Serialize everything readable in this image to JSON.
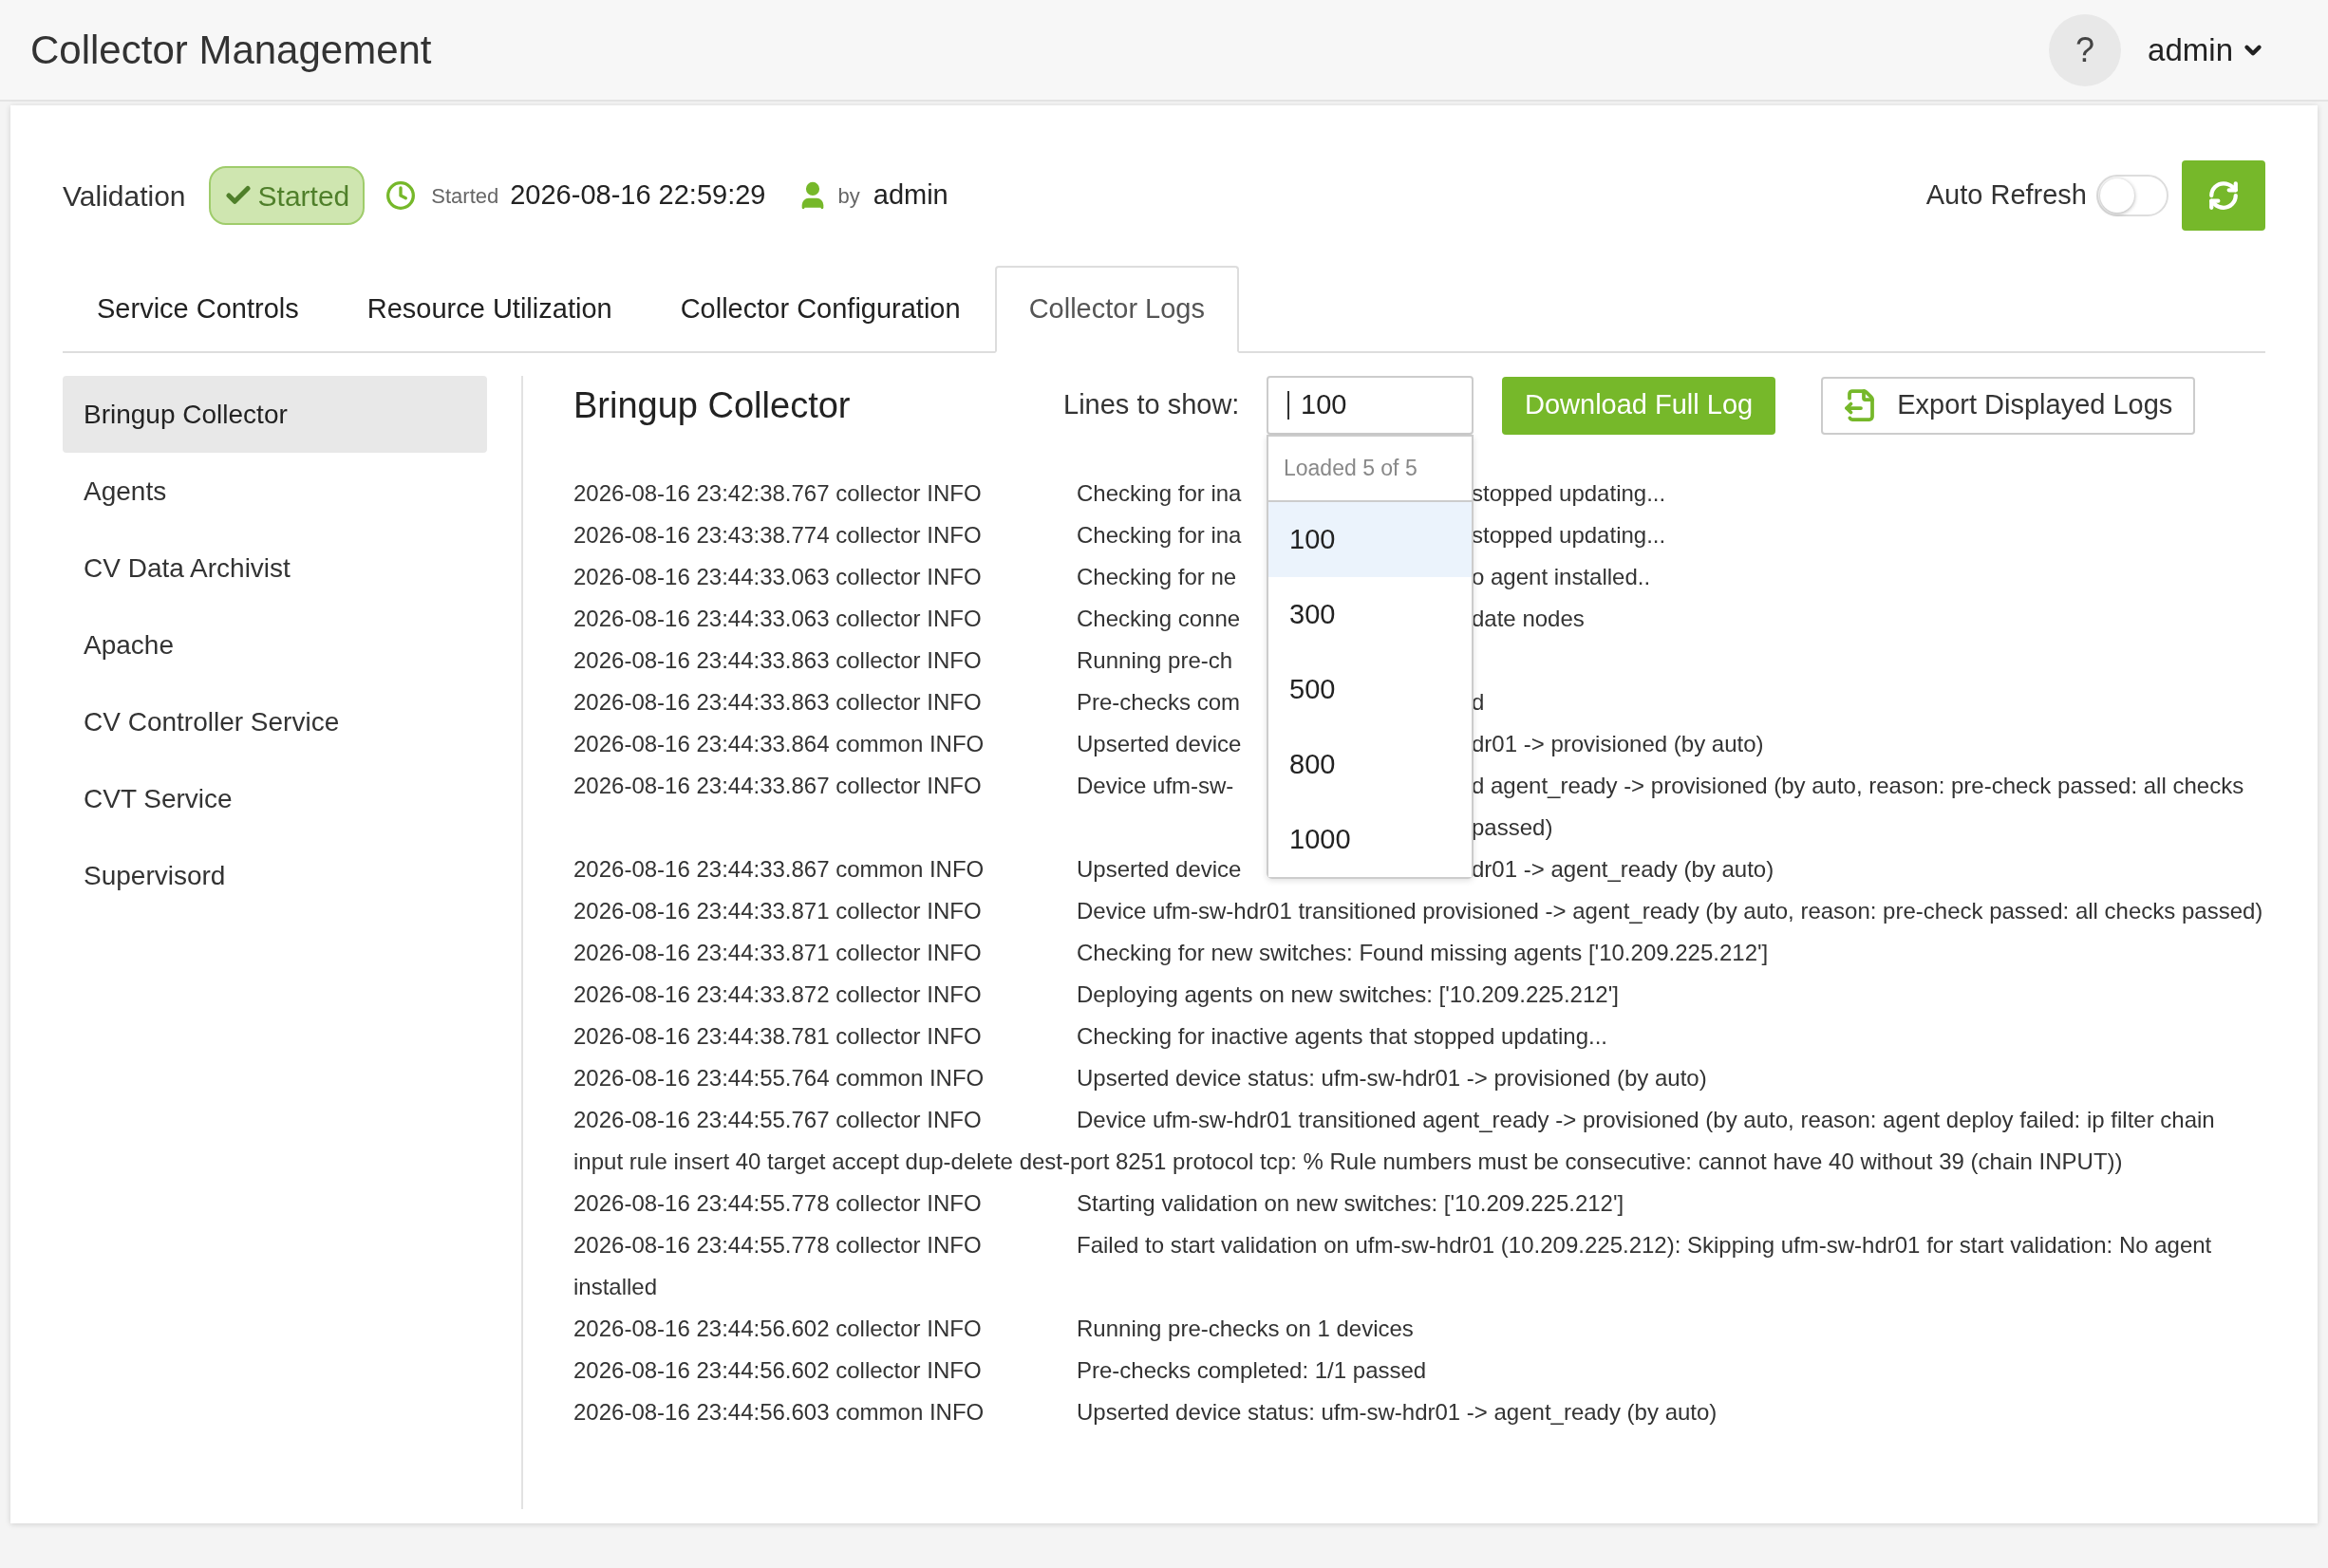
{
  "header": {
    "title": "Collector Management",
    "help": "?",
    "user": "admin"
  },
  "validation": {
    "label": "Validation",
    "status": {
      "text": "Started",
      "kind": "success"
    },
    "started_label": "Started",
    "started_at": "2026-08-16 22:59:29",
    "by_label": "by",
    "by_user": "admin",
    "auto_refresh": {
      "label": "Auto Refresh",
      "on": false
    }
  },
  "tabs": [
    {
      "label": "Service Controls",
      "selected": false
    },
    {
      "label": "Resource Utilization",
      "selected": false
    },
    {
      "label": "Collector Configuration",
      "selected": false
    },
    {
      "label": "Collector Logs",
      "selected": true
    }
  ],
  "sidebar": {
    "items": [
      {
        "label": "Bringup Collector",
        "selected": true
      },
      {
        "label": "Agents",
        "selected": false
      },
      {
        "label": "CV Data Archivist",
        "selected": false
      },
      {
        "label": "Apache",
        "selected": false
      },
      {
        "label": "CV Controller Service",
        "selected": false
      },
      {
        "label": "CVT Service",
        "selected": false
      },
      {
        "label": "Supervisord",
        "selected": false
      }
    ]
  },
  "logs": {
    "title": "Bringup Collector",
    "lines_label": "Lines to show:",
    "lines_value": "100",
    "dropdown": {
      "status": "Loaded 5 of 5",
      "options": [
        {
          "label": "100",
          "selected": true
        },
        {
          "label": "300",
          "selected": false
        },
        {
          "label": "500",
          "selected": false
        },
        {
          "label": "800",
          "selected": false
        },
        {
          "label": "1000",
          "selected": false
        }
      ]
    },
    "download_button": "Download Full Log",
    "export_button": "Export Displayed Logs",
    "rows": [
      {
        "prefix": "2026-08-16 23:42:38.767 collector INFO",
        "message": "Checking for ina",
        "message_after": "stopped updating..."
      },
      {
        "prefix": "2026-08-16 23:43:38.774 collector INFO",
        "message": "Checking for ina",
        "message_after": "stopped updating..."
      },
      {
        "prefix": "2026-08-16 23:44:33.063 collector INFO",
        "message": "Checking for ne",
        "message_after": "o agent installed.."
      },
      {
        "prefix": "2026-08-16 23:44:33.063 collector INFO",
        "message": "Checking conne",
        "message_after": "date nodes"
      },
      {
        "prefix": "2026-08-16 23:44:33.863 collector INFO",
        "message": "Running pre-ch"
      },
      {
        "prefix": "2026-08-16 23:44:33.863 collector INFO",
        "message": "Pre-checks com",
        "message_after": "d"
      },
      {
        "prefix": "2026-08-16 23:44:33.864 common INFO",
        "message": "Upserted device",
        "message_after": "dr01 -> provisioned (by auto)"
      },
      {
        "prefix": "2026-08-16 23:44:33.867 collector INFO",
        "message": "Device ufm-sw-",
        "message_after": "d agent_ready -> provisioned (by auto, reason: pre-check passed: all checks passed)"
      },
      {
        "prefix": "2026-08-16 23:44:33.867 common INFO",
        "message": "Upserted device",
        "message_after": "dr01 -> agent_ready (by auto)"
      },
      {
        "prefix": "2026-08-16 23:44:33.871 collector INFO",
        "message": "Device ufm-sw-hdr01 transitioned provisioned -> agent_ready (by auto, reason: pre-check passed: all checks passed)"
      },
      {
        "prefix": "2026-08-16 23:44:33.871 collector INFO",
        "message": "Checking for new switches: Found missing agents ['10.209.225.212']"
      },
      {
        "prefix": "2026-08-16 23:44:33.872 collector INFO",
        "message": "Deploying agents on new switches: ['10.209.225.212']"
      },
      {
        "prefix": "2026-08-16 23:44:38.781 collector INFO",
        "message": "Checking for inactive agents that stopped updating..."
      },
      {
        "prefix": "2026-08-16 23:44:55.764 common INFO",
        "message": "Upserted device status: ufm-sw-hdr01 -> provisioned (by auto)"
      },
      {
        "prefix": "2026-08-16 23:44:55.767 collector INFO",
        "message": "Device ufm-sw-hdr01 transitioned agent_ready -> provisioned (by auto, reason: agent deploy failed: ip filter chain input rule insert 40 target accept dup-delete dest-port 8251 protocol tcp: % Rule numbers must be consecutive: cannot have 40 without 39 (chain INPUT))"
      },
      {
        "prefix": "2026-08-16 23:44:55.778 collector INFO",
        "message": "Starting validation on new switches: ['10.209.225.212']"
      },
      {
        "prefix": "2026-08-16 23:44:55.778 collector INFO",
        "message": "Failed to start validation on ufm-sw-hdr01 (10.209.225.212): Skipping ufm-sw-hdr01 for start validation: No agent installed"
      },
      {
        "prefix": "2026-08-16 23:44:56.602 collector INFO",
        "message": "Running pre-checks on 1 devices"
      },
      {
        "prefix": "2026-08-16 23:44:56.602 collector INFO",
        "message": "Pre-checks completed: 1/1 passed"
      },
      {
        "prefix": "2026-08-16 23:44:56.603 common INFO",
        "message": "Upserted device status: ufm-sw-hdr01 -> agent_ready (by auto)"
      }
    ]
  }
}
